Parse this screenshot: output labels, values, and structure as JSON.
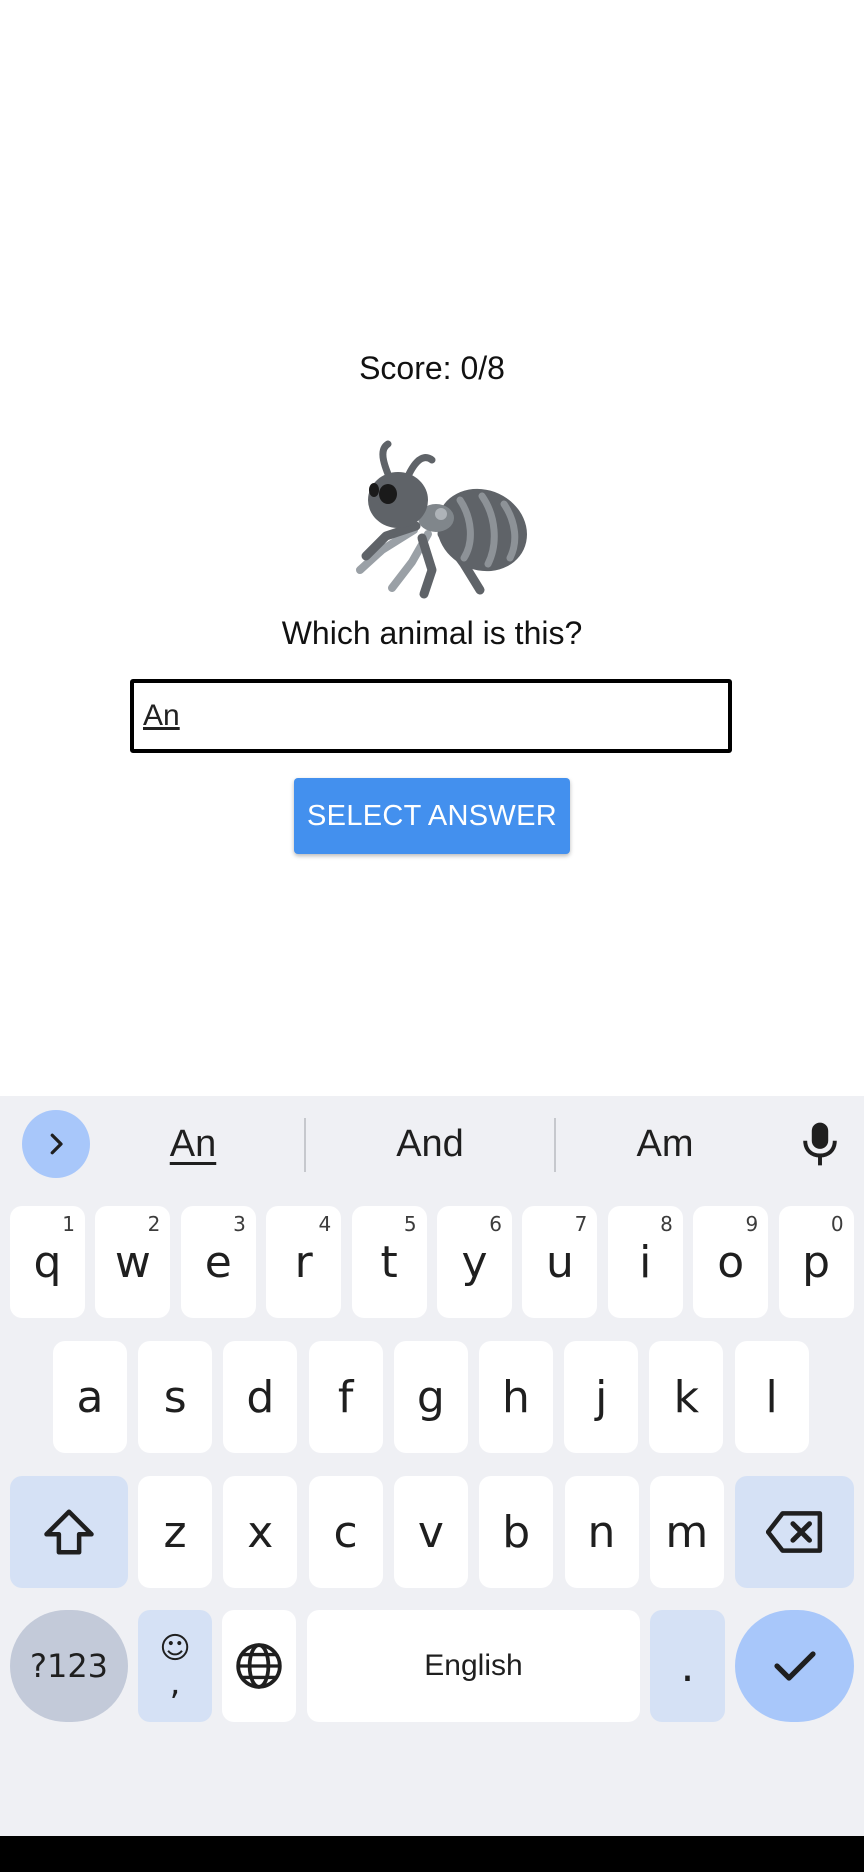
{
  "quiz": {
    "score_text": "Score: 0/8",
    "image_subject": "ant",
    "question": "Which animal is this?",
    "answer_value": "An",
    "submit_label": "SELECT ANSWER",
    "accent_color": "#4390ee"
  },
  "keyboard": {
    "suggestions": [
      "An",
      "And",
      "Am"
    ],
    "row1": [
      {
        "key": "q",
        "hint": "1"
      },
      {
        "key": "w",
        "hint": "2"
      },
      {
        "key": "e",
        "hint": "3"
      },
      {
        "key": "r",
        "hint": "4"
      },
      {
        "key": "t",
        "hint": "5"
      },
      {
        "key": "y",
        "hint": "6"
      },
      {
        "key": "u",
        "hint": "7"
      },
      {
        "key": "i",
        "hint": "8"
      },
      {
        "key": "o",
        "hint": "9"
      },
      {
        "key": "p",
        "hint": "0"
      }
    ],
    "row2": [
      "a",
      "s",
      "d",
      "f",
      "g",
      "h",
      "j",
      "k",
      "l"
    ],
    "row3": [
      "z",
      "x",
      "c",
      "v",
      "b",
      "n",
      "m"
    ],
    "symbols_label": "?123",
    "emoji_glyph": "☺",
    "comma": ",",
    "space_label": "English",
    "period": ".",
    "icons": {
      "expand": "chevron-right-icon",
      "mic": "mic-icon",
      "shift": "shift-icon",
      "backspace": "backspace-icon",
      "globe": "globe-icon",
      "enter": "check-icon"
    }
  }
}
